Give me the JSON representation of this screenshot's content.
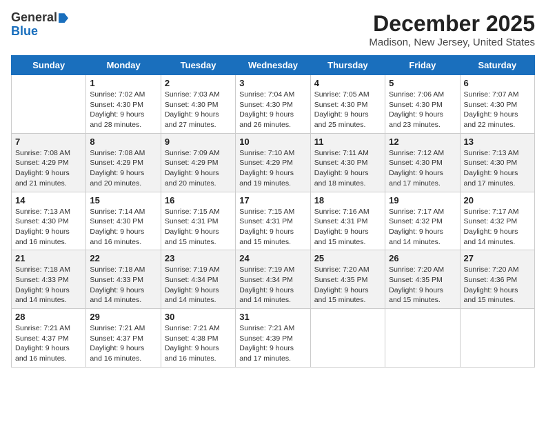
{
  "header": {
    "logo_general": "General",
    "logo_blue": "Blue",
    "month_title": "December 2025",
    "location": "Madison, New Jersey, United States"
  },
  "days_of_week": [
    "Sunday",
    "Monday",
    "Tuesday",
    "Wednesday",
    "Thursday",
    "Friday",
    "Saturday"
  ],
  "weeks": [
    [
      {
        "day": "",
        "sunrise": "",
        "sunset": "",
        "daylight": ""
      },
      {
        "day": "1",
        "sunrise": "Sunrise: 7:02 AM",
        "sunset": "Sunset: 4:30 PM",
        "daylight": "Daylight: 9 hours and 28 minutes."
      },
      {
        "day": "2",
        "sunrise": "Sunrise: 7:03 AM",
        "sunset": "Sunset: 4:30 PM",
        "daylight": "Daylight: 9 hours and 27 minutes."
      },
      {
        "day": "3",
        "sunrise": "Sunrise: 7:04 AM",
        "sunset": "Sunset: 4:30 PM",
        "daylight": "Daylight: 9 hours and 26 minutes."
      },
      {
        "day": "4",
        "sunrise": "Sunrise: 7:05 AM",
        "sunset": "Sunset: 4:30 PM",
        "daylight": "Daylight: 9 hours and 25 minutes."
      },
      {
        "day": "5",
        "sunrise": "Sunrise: 7:06 AM",
        "sunset": "Sunset: 4:30 PM",
        "daylight": "Daylight: 9 hours and 23 minutes."
      },
      {
        "day": "6",
        "sunrise": "Sunrise: 7:07 AM",
        "sunset": "Sunset: 4:30 PM",
        "daylight": "Daylight: 9 hours and 22 minutes."
      }
    ],
    [
      {
        "day": "7",
        "sunrise": "Sunrise: 7:08 AM",
        "sunset": "Sunset: 4:29 PM",
        "daylight": "Daylight: 9 hours and 21 minutes."
      },
      {
        "day": "8",
        "sunrise": "Sunrise: 7:08 AM",
        "sunset": "Sunset: 4:29 PM",
        "daylight": "Daylight: 9 hours and 20 minutes."
      },
      {
        "day": "9",
        "sunrise": "Sunrise: 7:09 AM",
        "sunset": "Sunset: 4:29 PM",
        "daylight": "Daylight: 9 hours and 20 minutes."
      },
      {
        "day": "10",
        "sunrise": "Sunrise: 7:10 AM",
        "sunset": "Sunset: 4:29 PM",
        "daylight": "Daylight: 9 hours and 19 minutes."
      },
      {
        "day": "11",
        "sunrise": "Sunrise: 7:11 AM",
        "sunset": "Sunset: 4:30 PM",
        "daylight": "Daylight: 9 hours and 18 minutes."
      },
      {
        "day": "12",
        "sunrise": "Sunrise: 7:12 AM",
        "sunset": "Sunset: 4:30 PM",
        "daylight": "Daylight: 9 hours and 17 minutes."
      },
      {
        "day": "13",
        "sunrise": "Sunrise: 7:13 AM",
        "sunset": "Sunset: 4:30 PM",
        "daylight": "Daylight: 9 hours and 17 minutes."
      }
    ],
    [
      {
        "day": "14",
        "sunrise": "Sunrise: 7:13 AM",
        "sunset": "Sunset: 4:30 PM",
        "daylight": "Daylight: 9 hours and 16 minutes."
      },
      {
        "day": "15",
        "sunrise": "Sunrise: 7:14 AM",
        "sunset": "Sunset: 4:30 PM",
        "daylight": "Daylight: 9 hours and 16 minutes."
      },
      {
        "day": "16",
        "sunrise": "Sunrise: 7:15 AM",
        "sunset": "Sunset: 4:31 PM",
        "daylight": "Daylight: 9 hours and 15 minutes."
      },
      {
        "day": "17",
        "sunrise": "Sunrise: 7:15 AM",
        "sunset": "Sunset: 4:31 PM",
        "daylight": "Daylight: 9 hours and 15 minutes."
      },
      {
        "day": "18",
        "sunrise": "Sunrise: 7:16 AM",
        "sunset": "Sunset: 4:31 PM",
        "daylight": "Daylight: 9 hours and 15 minutes."
      },
      {
        "day": "19",
        "sunrise": "Sunrise: 7:17 AM",
        "sunset": "Sunset: 4:32 PM",
        "daylight": "Daylight: 9 hours and 14 minutes."
      },
      {
        "day": "20",
        "sunrise": "Sunrise: 7:17 AM",
        "sunset": "Sunset: 4:32 PM",
        "daylight": "Daylight: 9 hours and 14 minutes."
      }
    ],
    [
      {
        "day": "21",
        "sunrise": "Sunrise: 7:18 AM",
        "sunset": "Sunset: 4:33 PM",
        "daylight": "Daylight: 9 hours and 14 minutes."
      },
      {
        "day": "22",
        "sunrise": "Sunrise: 7:18 AM",
        "sunset": "Sunset: 4:33 PM",
        "daylight": "Daylight: 9 hours and 14 minutes."
      },
      {
        "day": "23",
        "sunrise": "Sunrise: 7:19 AM",
        "sunset": "Sunset: 4:34 PM",
        "daylight": "Daylight: 9 hours and 14 minutes."
      },
      {
        "day": "24",
        "sunrise": "Sunrise: 7:19 AM",
        "sunset": "Sunset: 4:34 PM",
        "daylight": "Daylight: 9 hours and 14 minutes."
      },
      {
        "day": "25",
        "sunrise": "Sunrise: 7:20 AM",
        "sunset": "Sunset: 4:35 PM",
        "daylight": "Daylight: 9 hours and 15 minutes."
      },
      {
        "day": "26",
        "sunrise": "Sunrise: 7:20 AM",
        "sunset": "Sunset: 4:35 PM",
        "daylight": "Daylight: 9 hours and 15 minutes."
      },
      {
        "day": "27",
        "sunrise": "Sunrise: 7:20 AM",
        "sunset": "Sunset: 4:36 PM",
        "daylight": "Daylight: 9 hours and 15 minutes."
      }
    ],
    [
      {
        "day": "28",
        "sunrise": "Sunrise: 7:21 AM",
        "sunset": "Sunset: 4:37 PM",
        "daylight": "Daylight: 9 hours and 16 minutes."
      },
      {
        "day": "29",
        "sunrise": "Sunrise: 7:21 AM",
        "sunset": "Sunset: 4:37 PM",
        "daylight": "Daylight: 9 hours and 16 minutes."
      },
      {
        "day": "30",
        "sunrise": "Sunrise: 7:21 AM",
        "sunset": "Sunset: 4:38 PM",
        "daylight": "Daylight: 9 hours and 16 minutes."
      },
      {
        "day": "31",
        "sunrise": "Sunrise: 7:21 AM",
        "sunset": "Sunset: 4:39 PM",
        "daylight": "Daylight: 9 hours and 17 minutes."
      },
      {
        "day": "",
        "sunrise": "",
        "sunset": "",
        "daylight": ""
      },
      {
        "day": "",
        "sunrise": "",
        "sunset": "",
        "daylight": ""
      },
      {
        "day": "",
        "sunrise": "",
        "sunset": "",
        "daylight": ""
      }
    ]
  ]
}
